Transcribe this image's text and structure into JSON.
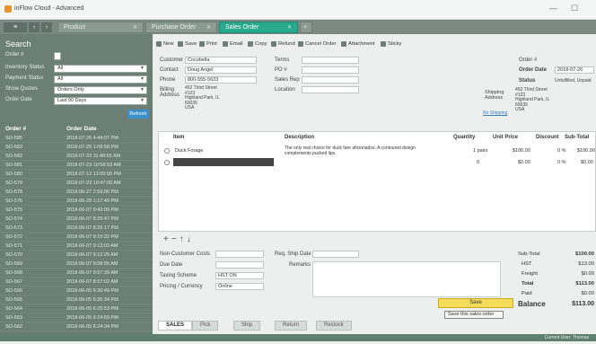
{
  "app": {
    "title": "inFlow Cloud - Advanced"
  },
  "tabs": [
    {
      "label": "Product",
      "active": false
    },
    {
      "label": "Purchase Order",
      "active": false
    },
    {
      "label": "Sales Order",
      "active": true
    }
  ],
  "sidebar": {
    "title": "Search",
    "filters": [
      {
        "label": "Order #",
        "value": ""
      },
      {
        "label": "Inventory Status",
        "value": "All"
      },
      {
        "label": "Payment Status",
        "value": "All"
      },
      {
        "label": "Show Quotes",
        "value": "Orders Only"
      },
      {
        "label": "Order Date",
        "value": "Last 90 Days"
      }
    ],
    "refresh_label": "Refresh",
    "list_headers": {
      "order": "Order #",
      "date": "Order Date"
    },
    "rows": [
      {
        "order": "SO-585",
        "date": "2018-07-26 4:44:07 PM"
      },
      {
        "order": "SO-583",
        "date": "2018-07-25 1:09:58 PM"
      },
      {
        "order": "SO-582",
        "date": "2018-07-23 11:48:55 AM"
      },
      {
        "order": "SO-581",
        "date": "2018-07-23 10:58:53 AM"
      },
      {
        "order": "SO-580",
        "date": "2018-07-12 12:00:00 PM"
      },
      {
        "order": "SO-579",
        "date": "2018-07-23 10:47:00 AM"
      },
      {
        "order": "SO-578",
        "date": "2018-06-27 2:59:06 PM"
      },
      {
        "order": "SO-576",
        "date": "2018-06-28 1:17:49 PM"
      },
      {
        "order": "SO-575",
        "date": "2018-06-07 9:43:09 PM"
      },
      {
        "order": "SO-574",
        "date": "2018-06-07 8:29:47 PM"
      },
      {
        "order": "SO-573",
        "date": "2018-06-07 8:29:17 PM"
      },
      {
        "order": "SO-572",
        "date": "2018-06-07 9:15:32 PM"
      },
      {
        "order": "SO-571",
        "date": "2018-06-07 9:13:03 AM"
      },
      {
        "order": "SO-570",
        "date": "2018-06-07 9:12:25 AM"
      },
      {
        "order": "SO-569",
        "date": "2018-06-07 9:08:05 AM"
      },
      {
        "order": "SO-568",
        "date": "2018-06-07 9:57:39 AM"
      },
      {
        "order": "SO-567",
        "date": "2018-06-07 8:57:02 AM"
      },
      {
        "order": "SO-566",
        "date": "2018-06-05 6:30:49 PM"
      },
      {
        "order": "SO-565",
        "date": "2018-06-05 6:26:34 PM"
      },
      {
        "order": "SO-564",
        "date": "2018-06-05 6:25:53 PM"
      },
      {
        "order": "SO-563",
        "date": "2018-06-05 6:24:59 PM"
      },
      {
        "order": "SO-562",
        "date": "2018-06-05 6:24:34 PM"
      }
    ]
  },
  "toolbar": {
    "new": "New",
    "save": "Save",
    "print": "Print",
    "email": "Email",
    "copy": "Copy",
    "refund": "Refund",
    "cancel": "Cancel Order",
    "attachment": "Attachment",
    "sticky": "Sticky"
  },
  "header": {
    "customer_label": "Customer",
    "customer": "Cocobella",
    "contact_label": "Contact",
    "contact": "Doug Angel",
    "phone_label": "Phone",
    "phone": "800-555-5633",
    "billing_label": "Billing Address",
    "billing": [
      "452 Third Street",
      "#123",
      "Highland Park, IL",
      "60035",
      "USA"
    ],
    "terms_label": "Terms",
    "po_label": "PO #",
    "rep_label": "Sales Rep",
    "location_label": "Location",
    "order_no_label": "Order #",
    "order_date_label": "Order Date",
    "order_date": "2018-07-26",
    "status_label": "Status",
    "status": "Unfulfilled, Unpaid",
    "shipping_label": "Shipping Address",
    "shipping": [
      "452 Third Street",
      "#123",
      "Highland Park, IL",
      "60035",
      "USA"
    ],
    "no_shipping": "No Shipping"
  },
  "items": {
    "headers": {
      "item": "Item",
      "description": "Description",
      "quantity": "Quantity",
      "unit_price": "Unit Price",
      "discount": "Discount",
      "subtotal": "Sub-Total"
    },
    "rows": [
      {
        "item": "Duck Forage",
        "description": "The only real choice for duck fare aficionados. A contoured design complements pucked lips.",
        "quantity": "1 pairs",
        "unit_price": "$100.00",
        "discount": "0 %",
        "subtotal": "$100.00"
      },
      {
        "item": "",
        "description": "",
        "quantity": "0",
        "unit_price": "$0.00",
        "discount": "0 %",
        "subtotal": "$0.00"
      }
    ]
  },
  "footer": {
    "non_customer_label": "Non-Customer Costs",
    "due_label": "Due Date",
    "tax_label": "Taxing Scheme",
    "tax": "HST ON",
    "pricing_label": "Pricing / Currency",
    "pricing": "Online",
    "req_ship_label": "Req. Ship Date",
    "remarks_label": "Remarks"
  },
  "totals": {
    "subtotal_label": "Sub-Total",
    "subtotal": "$100.00",
    "hst_label": "HST",
    "hst": "$13.00",
    "freight_label": "Freight",
    "freight": "$0.00",
    "total_label": "Total",
    "total": "$113.00",
    "paid_label": "Paid",
    "paid": "$0.00",
    "balance_label": "Balance",
    "balance": "$113.00"
  },
  "save_button": "Save",
  "tooltip": "Save this sales order",
  "bottom_tabs": [
    "SALES",
    "Pick",
    "Ship",
    "Return",
    "Restock"
  ],
  "status_bar": "Current User: Thomas"
}
